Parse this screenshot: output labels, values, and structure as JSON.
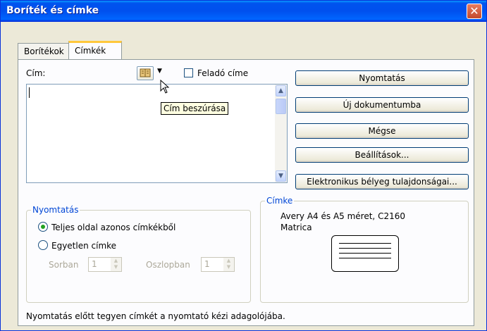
{
  "window": {
    "title": "Boríték és címke",
    "close_glyph": "✕"
  },
  "tabs": [
    {
      "label": "Borítékok"
    },
    {
      "label": "Címkék"
    }
  ],
  "address": {
    "label": "Cím:",
    "value": "",
    "insert_icon": "address-book-icon",
    "return_address_label": "Feladó címe",
    "return_address_checked": false
  },
  "tooltip": "Cím beszúrása",
  "buttons": {
    "print": "Nyomtatás",
    "new_document": "Új dokumentumba",
    "cancel": "Mégse",
    "options": "Beállítások...",
    "estamp": "Elektronikus bélyeg tulajdonságai..."
  },
  "print_group": {
    "title": "Nyomtatás",
    "option_full_page": "Teljes oldal azonos címkékből",
    "option_single": "Egyetlen címke",
    "selected": "full_page",
    "row_label": "Sorban",
    "row_value": "1",
    "column_label": "Oszlopban",
    "column_value": "1"
  },
  "label_group": {
    "title": "Címke",
    "description_line1": "Avery A4 és A5 méret, C2160",
    "description_line2": "Matrica"
  },
  "status": "Nyomtatás előtt tegyen címkét a nyomtató kézi adagolójába.",
  "colors": {
    "titlebar": "#0053ee",
    "tab_accent": "#ffc83c",
    "group_title": "#0046d5",
    "radio_dot": "#21a121"
  }
}
